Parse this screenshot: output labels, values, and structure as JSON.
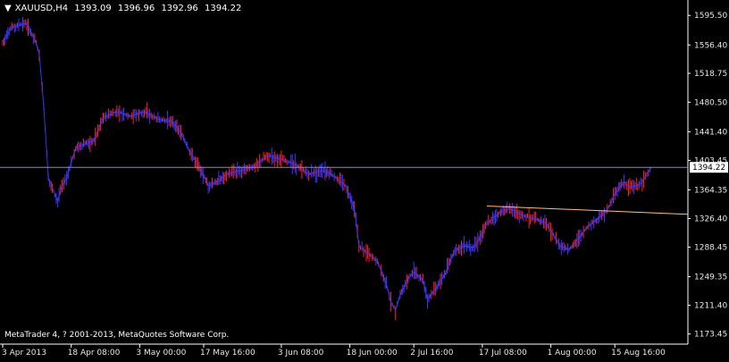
{
  "header": {
    "menu_glyph": "▼",
    "symbol": "XAUUSD,H4",
    "open": "1393.09",
    "high": "1396.96",
    "low": "1392.96",
    "close": "1394.22"
  },
  "footer": {
    "copyright": "MetaTrader 4, ? 2001-2013, MetaQuotes Software Corp."
  },
  "colors": {
    "background": "#000000",
    "axis": "#ffffff",
    "bull_bar": "#ff2020",
    "bear_bar": "#3a3aff",
    "price_line": "#8a8ab5",
    "trend_line": "#ffbf80",
    "price_label_bg": "#ffffff",
    "price_label_text": "#000000"
  },
  "chart_data": {
    "type": "line",
    "symbol": "XAUUSD",
    "timeframe": "H4",
    "ylim": [
      1160,
      1610
    ],
    "y_ticks": [
      "1595.50",
      "1556.40",
      "1518.75",
      "1480.50",
      "1441.40",
      "1403.45",
      "1364.35",
      "1326.40",
      "1288.45",
      "1249.35",
      "1211.40",
      "1173.45"
    ],
    "x_ticks": [
      "3 Apr 2013",
      "18 Apr 08:00",
      "3 May 00:00",
      "17 May 16:00",
      "3 Jun 08:00",
      "18 Jun 00:00",
      "2 Jul 16:00",
      "17 Jul 08:00",
      "1 Aug 00:00",
      "15 Aug 16:00"
    ],
    "current_price": "1394.22",
    "price_series": [
      {
        "date": "2013-04-03",
        "price": 1560
      },
      {
        "date": "2013-04-05",
        "price": 1580
      },
      {
        "date": "2013-04-08",
        "price": 1585
      },
      {
        "date": "2013-04-10",
        "price": 1565
      },
      {
        "date": "2013-04-11",
        "price": 1545
      },
      {
        "date": "2013-04-12",
        "price": 1475
      },
      {
        "date": "2013-04-13",
        "price": 1380
      },
      {
        "date": "2013-04-15",
        "price": 1350
      },
      {
        "date": "2013-04-16",
        "price": 1370
      },
      {
        "date": "2013-04-17",
        "price": 1380
      },
      {
        "date": "2013-04-18",
        "price": 1400
      },
      {
        "date": "2013-04-19",
        "price": 1420
      },
      {
        "date": "2013-04-23",
        "price": 1430
      },
      {
        "date": "2013-04-25",
        "price": 1460
      },
      {
        "date": "2013-04-28",
        "price": 1468
      },
      {
        "date": "2013-05-01",
        "price": 1462
      },
      {
        "date": "2013-05-04",
        "price": 1468
      },
      {
        "date": "2013-05-07",
        "price": 1458
      },
      {
        "date": "2013-05-10",
        "price": 1455
      },
      {
        "date": "2013-05-12",
        "price": 1440
      },
      {
        "date": "2013-05-14",
        "price": 1415
      },
      {
        "date": "2013-05-16",
        "price": 1395
      },
      {
        "date": "2013-05-18",
        "price": 1370
      },
      {
        "date": "2013-05-20",
        "price": 1375
      },
      {
        "date": "2013-05-22",
        "price": 1385
      },
      {
        "date": "2013-05-25",
        "price": 1390
      },
      {
        "date": "2013-05-28",
        "price": 1395
      },
      {
        "date": "2013-05-31",
        "price": 1410
      },
      {
        "date": "2013-06-03",
        "price": 1405
      },
      {
        "date": "2013-06-06",
        "price": 1398
      },
      {
        "date": "2013-06-09",
        "price": 1385
      },
      {
        "date": "2013-06-12",
        "price": 1390
      },
      {
        "date": "2013-06-14",
        "price": 1385
      },
      {
        "date": "2013-06-17",
        "price": 1370
      },
      {
        "date": "2013-06-19",
        "price": 1340
      },
      {
        "date": "2013-06-20",
        "price": 1290
      },
      {
        "date": "2013-06-21",
        "price": 1285
      },
      {
        "date": "2013-06-24",
        "price": 1270
      },
      {
        "date": "2013-06-26",
        "price": 1240
      },
      {
        "date": "2013-06-27",
        "price": 1215
      },
      {
        "date": "2013-06-28",
        "price": 1205
      },
      {
        "date": "2013-06-29",
        "price": 1225
      },
      {
        "date": "2013-07-01",
        "price": 1250
      },
      {
        "date": "2013-07-02",
        "price": 1255
      },
      {
        "date": "2013-07-04",
        "price": 1245
      },
      {
        "date": "2013-07-05",
        "price": 1220
      },
      {
        "date": "2013-07-07",
        "price": 1235
      },
      {
        "date": "2013-07-09",
        "price": 1255
      },
      {
        "date": "2013-07-11",
        "price": 1285
      },
      {
        "date": "2013-07-13",
        "price": 1290
      },
      {
        "date": "2013-07-15",
        "price": 1288
      },
      {
        "date": "2013-07-16",
        "price": 1295
      },
      {
        "date": "2013-07-18",
        "price": 1320
      },
      {
        "date": "2013-07-19",
        "price": 1325
      },
      {
        "date": "2013-07-21",
        "price": 1335
      },
      {
        "date": "2013-07-23",
        "price": 1340
      },
      {
        "date": "2013-07-26",
        "price": 1330
      },
      {
        "date": "2013-07-29",
        "price": 1325
      },
      {
        "date": "2013-07-31",
        "price": 1320
      },
      {
        "date": "2013-08-01",
        "price": 1310
      },
      {
        "date": "2013-08-03",
        "price": 1290
      },
      {
        "date": "2013-08-05",
        "price": 1285
      },
      {
        "date": "2013-08-07",
        "price": 1300
      },
      {
        "date": "2013-08-09",
        "price": 1315
      },
      {
        "date": "2013-08-11",
        "price": 1325
      },
      {
        "date": "2013-08-13",
        "price": 1335
      },
      {
        "date": "2013-08-14",
        "price": 1345
      },
      {
        "date": "2013-08-15",
        "price": 1360
      },
      {
        "date": "2013-08-17",
        "price": 1375
      },
      {
        "date": "2013-08-18",
        "price": 1368
      },
      {
        "date": "2013-08-20",
        "price": 1370
      },
      {
        "date": "2013-08-21",
        "price": 1375
      },
      {
        "date": "2013-08-22",
        "price": 1385
      },
      {
        "date": "2013-08-23",
        "price": 1394
      }
    ],
    "trend_line": [
      {
        "date": "2013-07-18",
        "price": 1343
      },
      {
        "date": "2013-08-31",
        "price": 1332
      }
    ]
  }
}
